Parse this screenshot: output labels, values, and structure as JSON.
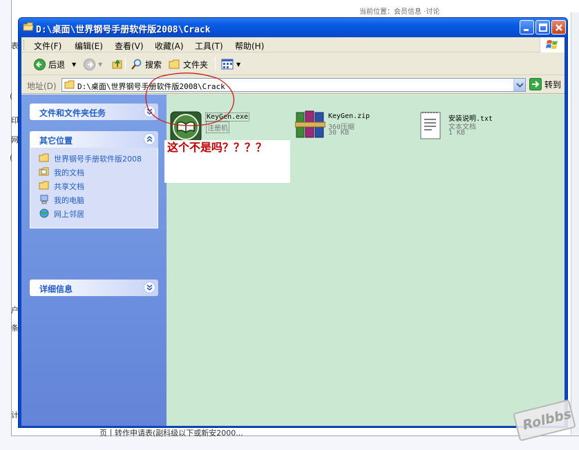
{
  "background": {
    "top_snippet": "当前位置：会员信息 ·讨论",
    "side_chars": [
      "表",
      "(",
      "印",
      "网",
      "(",
      "户",
      "条",
      "计"
    ],
    "bottom_snippet": "页丨转作申请表(副科级以下或新安2000..."
  },
  "window": {
    "title": "D:\\桌面\\世界钢号手册软件版2008\\Crack"
  },
  "menu": {
    "items": [
      "文件(F)",
      "编辑(E)",
      "查看(V)",
      "收藏(A)",
      "工具(T)",
      "帮助(H)"
    ]
  },
  "toolbar": {
    "back_label": "后退",
    "search_label": "搜索",
    "folders_label": "文件夹"
  },
  "address": {
    "label": "地址(D)",
    "value": "D:\\桌面\\世界钢号手册软件版2008\\Crack",
    "go_label": "转到"
  },
  "tasks": {
    "file_tasks_title": "文件和文件夹任务",
    "other_places_title": "其它位置",
    "places": [
      "世界钢号手册软件版2008",
      "我的文档",
      "共享文档",
      "我的电脑",
      "网上邻居"
    ],
    "details_title": "详细信息"
  },
  "files": [
    {
      "name": "KeyGen.exe",
      "type": "注册机",
      "size": ""
    },
    {
      "name": "KeyGen.zip",
      "type": "360压缩",
      "size": "30 KB"
    },
    {
      "name": "安装说明.txt",
      "type": "文本文档",
      "size": "1 KB"
    }
  ],
  "annotation": {
    "text": "这个不是吗？？？？",
    "color": "#c00000"
  },
  "colors": {
    "titlebar": "#0650d8",
    "content_bg": "#cbe8d3",
    "task_pane": "#6f91dd",
    "link": "#215dc6"
  },
  "watermark": "Rolbbs"
}
